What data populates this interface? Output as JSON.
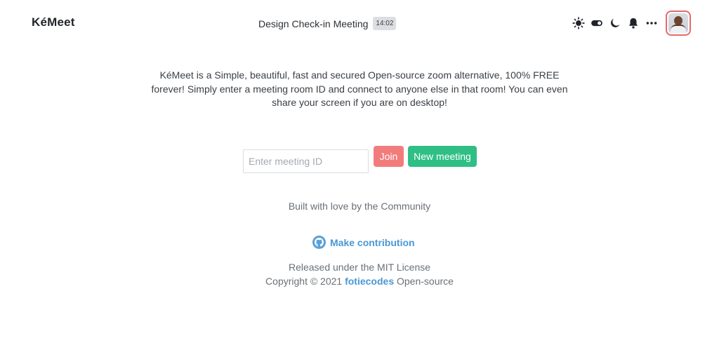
{
  "header": {
    "brand": "KéMeet",
    "meeting_title": "Design Check-in Meeting",
    "meeting_time": "14:02",
    "icons": [
      "sun-icon",
      "toggle-icon",
      "moon-icon",
      "bell-icon",
      "more-icon",
      "avatar"
    ]
  },
  "intro": {
    "text": "KéMeet is a Simple, beautiful, fast and secured Open-source zoom alternative, 100% FREE forever! Simply enter a meeting room ID and connect to anyone else in that room! You can even share your screen if you are on desktop!"
  },
  "join": {
    "placeholder": "Enter meeting ID",
    "value": "",
    "join_label": "Join",
    "new_meeting_label": "New meeting"
  },
  "footer": {
    "built_with": "Built with love by the Community",
    "contribution_label": "Make contribution",
    "license": "Released under the MIT License",
    "copyright_prefix": "Copyright © 2021 ",
    "author": "fotiecodes",
    "copyright_suffix": " Open-source"
  },
  "colors": {
    "join_button": "#f27c7c",
    "new_meeting_button": "#2fbf85",
    "link": "#4a97d4",
    "avatar_border": "#e46a6a"
  }
}
